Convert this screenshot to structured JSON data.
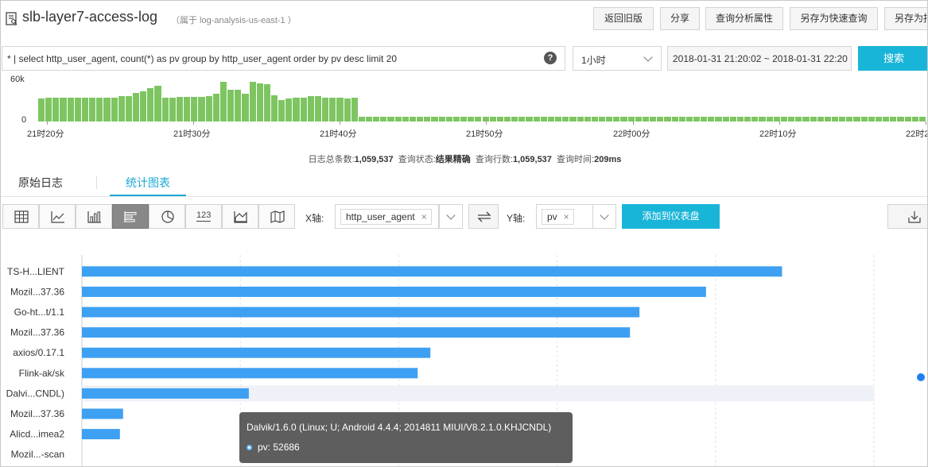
{
  "header": {
    "title": "slb-layer7-access-log",
    "subtitle": "（属于 log-analysis-us-east-1 ）",
    "buttons": [
      "返回旧版",
      "分享",
      "查询分析属性",
      "另存为快速查询",
      "另存为报"
    ]
  },
  "query": {
    "text": "* | select http_user_agent, count(*) as pv group by http_user_agent order by pv desc limit 20",
    "help": "?",
    "time_select": "1小时",
    "range": "2018-01-31 21:20:02 ~ 2018-01-31 22:20",
    "search_label": "搜索"
  },
  "histogram": {
    "y_top": "60k",
    "y_bottom": "0",
    "x_labels": [
      "21时20分",
      "21时30分",
      "21时40分",
      "21时50分",
      "22时00分",
      "22时10分",
      "22时2"
    ],
    "levels": [
      0.46,
      0.48,
      0.48,
      0.48,
      0.48,
      0.48,
      0.48,
      0.48,
      0.48,
      0.48,
      0.48,
      0.52,
      0.52,
      0.58,
      0.62,
      0.68,
      0.72,
      0.48,
      0.48,
      0.5,
      0.5,
      0.5,
      0.5,
      0.52,
      0.56,
      0.8,
      0.64,
      0.64,
      0.56,
      0.8,
      0.78,
      0.76,
      0.54,
      0.44,
      0.46,
      0.48,
      0.48,
      0.52,
      0.52,
      0.48,
      0.48,
      0.48,
      0.46,
      0.48,
      0.1,
      0.1,
      0.1,
      0.1,
      0.1,
      0.1,
      0.1,
      0.1,
      0.1,
      0.1,
      0.1,
      0.1,
      0.1,
      0.1,
      0.1,
      0.1,
      0.1,
      0.1,
      0.1,
      0.1,
      0.1,
      0.1,
      0.1,
      0.1,
      0.1,
      0.1,
      0.1,
      0.1,
      0.1,
      0.1,
      0.1,
      0.1,
      0.1,
      0.1,
      0.1,
      0.1,
      0.1,
      0.1,
      0.1,
      0.1,
      0.1,
      0.1,
      0.1,
      0.1,
      0.1,
      0.1,
      0.1,
      0.1,
      0.1,
      0.1,
      0.1,
      0.1,
      0.1,
      0.1,
      0.1,
      0.1,
      0.1,
      0.1,
      0.1,
      0.1,
      0.1,
      0.1,
      0.1,
      0.1,
      0.1,
      0.1,
      0.1,
      0.1,
      0.1,
      0.1,
      0.1,
      0.1,
      0.1,
      0.1,
      0.1,
      0.1,
      0.1,
      0.1
    ],
    "bar_color": "#7ec562"
  },
  "stats": {
    "count_label": "日志总条数:",
    "count": "1,059,537",
    "status_label": "查询状态:",
    "status": "结果精确",
    "rows_label": "查询行数:",
    "rows": "1,059,537",
    "time_label": "查询时间:",
    "time": "209ms"
  },
  "tabs": [
    "原始日志",
    "统计图表"
  ],
  "toolbar": {
    "chart_icons": [
      "table-icon",
      "line-chart-icon",
      "column-chart-icon",
      "bar-chart-icon",
      "pie-chart-icon",
      "number-icon",
      "area-chart-icon",
      "map-icon"
    ],
    "number_icon_text": "123",
    "x_axis_label": "X轴:",
    "x_field": "http_user_agent",
    "y_axis_label": "Y轴:",
    "y_field": "pv",
    "tag_remove": "×",
    "add_label": "添加到仪表盘"
  },
  "chart_data": {
    "type": "bar",
    "orientation": "horizontal",
    "categories": [
      "TS-H...LIENT",
      "Mozil...37.36",
      "Go-ht...t/1.1",
      "Mozil...37.36",
      "axios/0.17.1",
      "Flink-ak/sk",
      "Dalvi...CNDL)",
      "Mozil...37.36",
      "Alicd...imea2",
      "Mozil...-scan"
    ],
    "series": [
      {
        "values": [
          221000,
          197000,
          176000,
          173000,
          110000,
          106000,
          52686,
          13000,
          12000,
          0
        ]
      }
    ],
    "xlim": [
      0,
      250000
    ],
    "highlight_index": 6,
    "bar_color": "#3ea0f2",
    "grid": true
  },
  "tooltip": {
    "title": "Dalvik/1.6.0 (Linux; U; Android 4.4.4; 2014811 MIUI/V8.2.1.0.KHJCNDL)",
    "value": "pv: 52686"
  }
}
